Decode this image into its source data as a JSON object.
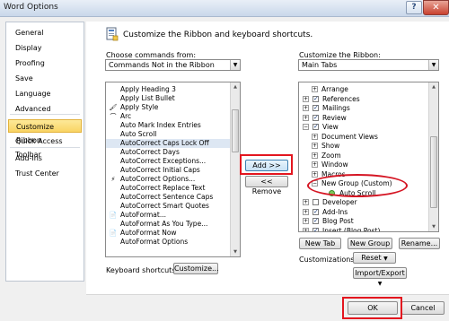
{
  "window": {
    "title": "Word Options",
    "help_glyph": "?",
    "close_glyph": "✕"
  },
  "nav": {
    "items": [
      {
        "label": "General",
        "selected": false
      },
      {
        "label": "Display",
        "selected": false
      },
      {
        "label": "Proofing",
        "selected": false
      },
      {
        "label": "Save",
        "selected": false
      },
      {
        "label": "Language",
        "selected": false
      },
      {
        "label": "Advanced",
        "selected": false
      },
      {
        "label": "Customize Ribbon",
        "selected": true
      },
      {
        "label": "Quick Access Toolbar",
        "selected": false
      },
      {
        "label": "Add-Ins",
        "selected": false
      },
      {
        "label": "Trust Center",
        "selected": false
      }
    ]
  },
  "header": {
    "title": "Customize the Ribbon and keyboard shortcuts."
  },
  "left": {
    "choose_label": "Choose commands from:",
    "choose_value": "Commands Not in the Ribbon",
    "commands": [
      {
        "label": "Apply Heading 3",
        "icon": ""
      },
      {
        "label": "Apply List Bullet",
        "icon": ""
      },
      {
        "label": "Apply Style",
        "icon": "brush-icon"
      },
      {
        "label": "Arc",
        "icon": "arc-icon"
      },
      {
        "label": "Auto Mark Index Entries",
        "icon": ""
      },
      {
        "label": "Auto Scroll",
        "icon": ""
      },
      {
        "label": "AutoCorrect Caps Lock Off",
        "icon": ""
      },
      {
        "label": "AutoCorrect Days",
        "icon": ""
      },
      {
        "label": "AutoCorrect Exceptions...",
        "icon": ""
      },
      {
        "label": "AutoCorrect Initial Caps",
        "icon": ""
      },
      {
        "label": "AutoCorrect Options...",
        "icon": "lightning-icon"
      },
      {
        "label": "AutoCorrect Replace Text",
        "icon": ""
      },
      {
        "label": "AutoCorrect Sentence Caps",
        "icon": ""
      },
      {
        "label": "AutoCorrect Smart Quotes",
        "icon": ""
      },
      {
        "label": "AutoFormat...",
        "icon": "document-icon"
      },
      {
        "label": "AutoFormat As You Type...",
        "icon": ""
      },
      {
        "label": "AutoFormat Now",
        "icon": "document-icon"
      },
      {
        "label": "AutoFormat Options",
        "icon": ""
      }
    ],
    "keyboard_label": "Keyboard shortcuts:",
    "customize_btn": "Customize..."
  },
  "middle": {
    "add_btn": "Add >>",
    "remove_btn": "<< Remove"
  },
  "right": {
    "customize_label": "Customize the Ribbon:",
    "customize_value": "Main Tabs",
    "tree": [
      {
        "label": "Arrange",
        "indent": 2,
        "exp": "+",
        "cb": false
      },
      {
        "label": "References",
        "indent": 1,
        "exp": "+",
        "cb": true
      },
      {
        "label": "Mailings",
        "indent": 1,
        "exp": "+",
        "cb": true
      },
      {
        "label": "Review",
        "indent": 1,
        "exp": "+",
        "cb": true
      },
      {
        "label": "View",
        "indent": 1,
        "exp": "−",
        "cb": true
      },
      {
        "label": "Document Views",
        "indent": 2,
        "exp": "+",
        "cb": false
      },
      {
        "label": "Show",
        "indent": 2,
        "exp": "+",
        "cb": false
      },
      {
        "label": "Zoom",
        "indent": 2,
        "exp": "+",
        "cb": false
      },
      {
        "label": "Window",
        "indent": 2,
        "exp": "+",
        "cb": false
      },
      {
        "label": "Macros",
        "indent": 2,
        "exp": "+",
        "cb": false
      },
      {
        "label": "New Group (Custom)",
        "indent": 2,
        "exp": "−",
        "cb": false
      },
      {
        "label": "Auto Scroll",
        "indent": 3,
        "exp": "",
        "cb": false
      },
      {
        "label": "Developer",
        "indent": 1,
        "exp": "+",
        "cb": false
      },
      {
        "label": "Add-Ins",
        "indent": 1,
        "exp": "+",
        "cb": true
      },
      {
        "label": "Blog Post",
        "indent": 1,
        "exp": "+",
        "cb": true
      },
      {
        "label": "Insert (Blog Post)",
        "indent": 1,
        "exp": "+",
        "cb": true
      }
    ],
    "new_tab_btn": "New Tab",
    "new_group_btn": "New Group",
    "rename_btn": "Rename...",
    "customizations_label": "Customizations:",
    "reset_btn": "Reset",
    "import_export_btn": "Import/Export"
  },
  "footer": {
    "ok_btn": "OK",
    "cancel_btn": "Cancel"
  }
}
